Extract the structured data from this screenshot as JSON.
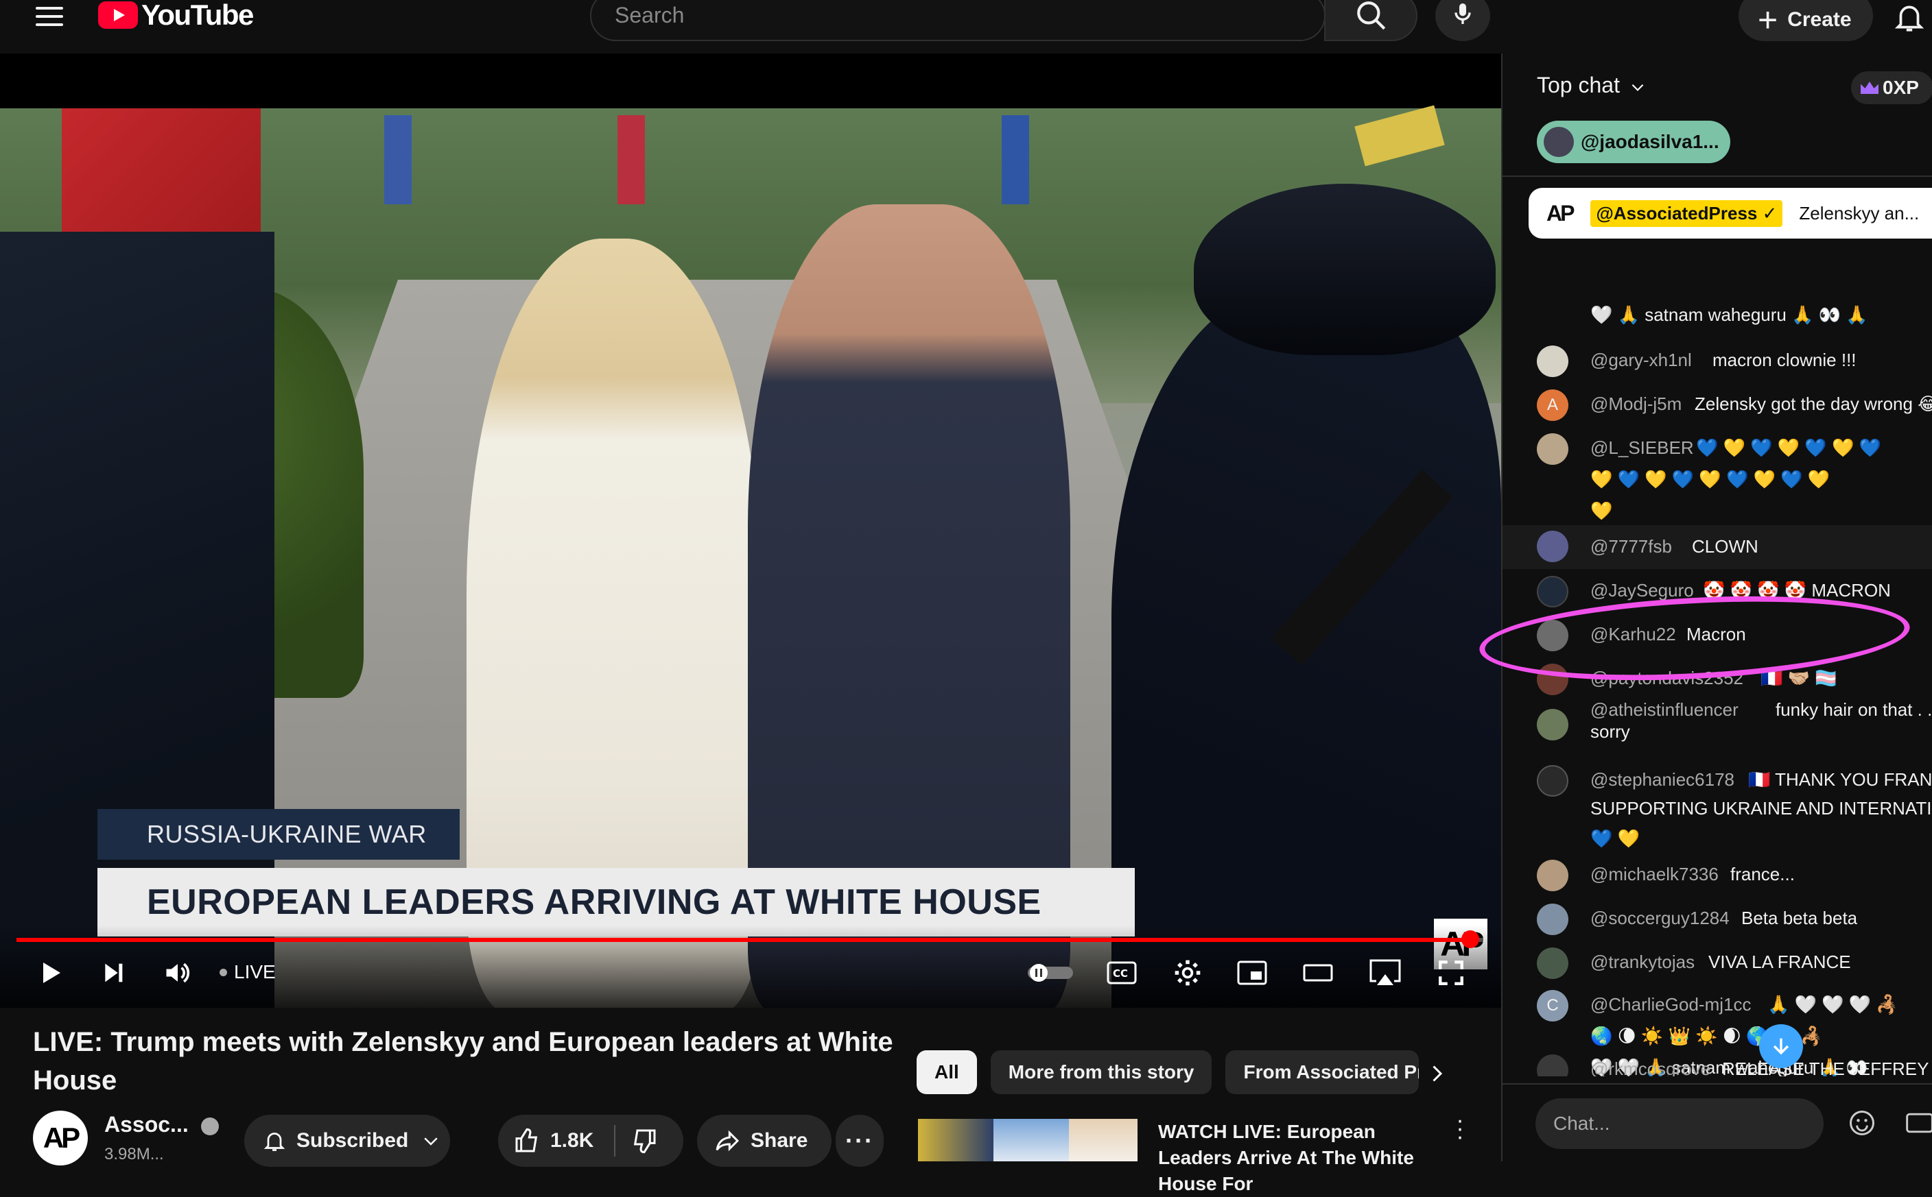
{
  "header": {
    "logo_text": "YouTube",
    "search_placeholder": "Search",
    "create_label": "Create"
  },
  "player": {
    "lower_third_tag": "RUSSIA-UKRAINE WAR",
    "lower_third_headline": "EUROPEAN LEADERS ARRIVING AT WHITE HOUSE",
    "watermark": "AP",
    "live_label": "LIVE",
    "progress": 0.99
  },
  "video": {
    "title": "LIVE: Trump meets with Zelenskyy and European leaders at White House",
    "channel_name": "Assoc...",
    "channel_avatar": "AP",
    "subscribers": "3.98M...",
    "subscribed_label": "Subscribed",
    "likes": "1.8K",
    "share_label": "Share"
  },
  "related": {
    "chips": [
      {
        "label": "All",
        "active": true
      },
      {
        "label": "More from this story",
        "active": false
      },
      {
        "label": "From Associated Pre",
        "active": false
      }
    ],
    "next_title": "WATCH LIVE: European Leaders Arrive At The White House For"
  },
  "chat": {
    "mode_label": "Top chat",
    "xp_label": "0XP",
    "ticker_handle": "@jaodasilva1...",
    "pinned": {
      "avatar": "AP",
      "handle": "@AssociatedPress",
      "text": "Zelenskyy an..."
    },
    "messages": [
      {
        "author": "",
        "text": "🤍 🙏 satnam waheguru 🙏 👀 🙏",
        "avatar": ""
      },
      {
        "author": "@gary-xh1nl",
        "text": "macron clownie !!!",
        "avatar": "#d7d2c6"
      },
      {
        "author": "@Modj-j5m",
        "text": "Zelensky got the day wrong 😂",
        "avatar": "#e0763a",
        "initial": "A"
      },
      {
        "author": "@L_SIEBER",
        "text": "💙 💛 💙 💛 💙 💛 💙",
        "cont1": "💛 💙 💛 💙 💛 💙 💛 💙 💛",
        "cont2": "💛",
        "avatar": "#b8a58a"
      },
      {
        "author": "@7777fsb",
        "text": "CLOWN",
        "avatar": "#5b5e8f"
      },
      {
        "author": "@JaySeguro",
        "text": "🤡 🤡 🤡 🤡 MACRON",
        "avatar": "#1f2a3a"
      },
      {
        "author": "@Karhu22",
        "text": "Macron",
        "avatar": "#6c6c6c"
      },
      {
        "author": "@paytondavis2352",
        "text": "🇫🇷 🤝🏼 🏳️‍⚧️",
        "avatar": "#6d3a30"
      },
      {
        "author": "@atheistinfluencer",
        "text": "funky hair on that . . . lo",
        "cont1": "sorry",
        "avatar": "#6c7a5c"
      },
      {
        "author": "@stephaniec6178",
        "text": "🇫🇷 THANK YOU FRAN",
        "cont1": "SUPPORTING UKRAINE AND INTERNATION",
        "cont2": "💙 💛",
        "avatar": "#2a2a2a"
      },
      {
        "author": "@michaelk7336",
        "text": "france...",
        "avatar": "#b49a7e"
      },
      {
        "author": "@soccerguy1284",
        "text": "Beta beta beta",
        "avatar": "#8090a4"
      },
      {
        "author": "@trankytojas",
        "text": "VIVA LA FRANCE",
        "avatar": "#4a5a4a"
      },
      {
        "author": "@CharlieGod-mj1cc",
        "text": "🙏 🤍 🤍 🤍 🦂",
        "cont1": "🌏 🌘 ☀️ 👑 ☀️ 🌒 🌎 ⭐ 🦂",
        "cont2": "🤍 🤍 🙏 satnam waheguru 🙏 👀",
        "avatar": "#8a9aae",
        "initial": "C"
      },
      {
        "author": "@rkmcosgrove",
        "text": "RELEASE THE JEFFREY EP",
        "avatar": "#3a3a3a"
      }
    ],
    "input_placeholder": "Chat..."
  },
  "colors": {
    "background": "#0f0f0f",
    "accent_red": "#ff0000",
    "highlight_magenta": "#f050ea",
    "ticker_green": "#7cc2a7"
  }
}
